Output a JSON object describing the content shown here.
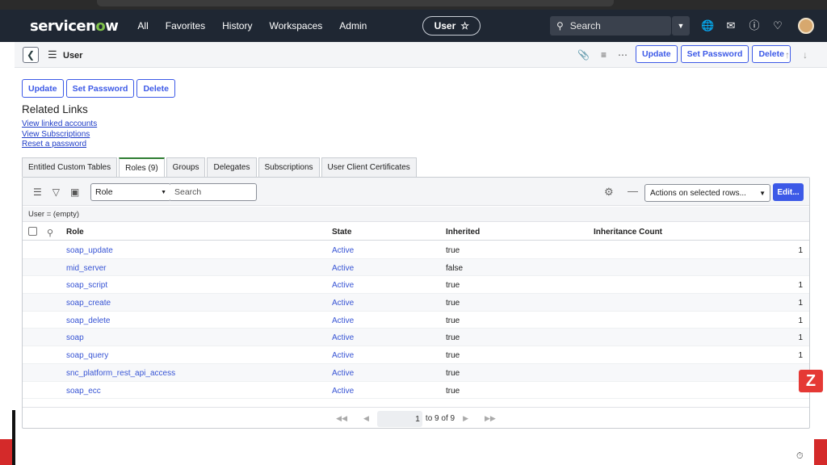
{
  "topnav": {
    "logo_text": "servicen",
    "logo_o": "o",
    "logo_tail": "w",
    "links": [
      "All",
      "Favorites",
      "History",
      "Workspaces",
      "Admin"
    ],
    "context_pill": "User",
    "star_icon": "☆",
    "search_placeholder": "Search",
    "icons": [
      "globe-icon",
      "chat-icon",
      "help-icon",
      "bell-icon"
    ]
  },
  "form_header": {
    "title": "User",
    "buttons": [
      "Update",
      "Set Password",
      "Delete"
    ]
  },
  "form_bottom": {
    "buttons": [
      "Update",
      "Set Password",
      "Delete"
    ]
  },
  "related_links": {
    "title": "Related Links",
    "links": [
      "View linked accounts",
      "View Subscriptions",
      "Reset a password"
    ]
  },
  "tabs": [
    {
      "label": "Entitled Custom Tables",
      "active": false
    },
    {
      "label": "Roles (9)",
      "active": true
    },
    {
      "label": "Groups",
      "active": false
    },
    {
      "label": "Delegates",
      "active": false
    },
    {
      "label": "Subscriptions",
      "active": false
    },
    {
      "label": "User Client Certificates",
      "active": false
    }
  ],
  "list": {
    "field_select": "Role",
    "search_placeholder": "Search",
    "actions_select": "Actions on selected rows...",
    "edit_button": "Edit...",
    "filter_text": "User = (empty)",
    "columns": [
      "Role",
      "State",
      "Inherited",
      "Inheritance Count"
    ],
    "rows": [
      {
        "role": "soap_update",
        "state": "Active",
        "inherited": "true",
        "count": "1"
      },
      {
        "role": "mid_server",
        "state": "Active",
        "inherited": "false",
        "count": ""
      },
      {
        "role": "soap_script",
        "state": "Active",
        "inherited": "true",
        "count": "1"
      },
      {
        "role": "soap_create",
        "state": "Active",
        "inherited": "true",
        "count": "1"
      },
      {
        "role": "soap_delete",
        "state": "Active",
        "inherited": "true",
        "count": "1"
      },
      {
        "role": "soap",
        "state": "Active",
        "inherited": "true",
        "count": "1"
      },
      {
        "role": "soap_query",
        "state": "Active",
        "inherited": "true",
        "count": "1"
      },
      {
        "role": "snc_platform_rest_api_access",
        "state": "Active",
        "inherited": "true",
        "count": ""
      },
      {
        "role": "soap_ecc",
        "state": "Active",
        "inherited": "true",
        "count": ""
      }
    ],
    "pager": {
      "current": "1",
      "text": "to 9 of 9"
    }
  },
  "colors": {
    "nav_bg": "#1f2733",
    "accent": "#3c59e7",
    "link": "#1f3dc7",
    "logo_green": "#7fc24a"
  }
}
